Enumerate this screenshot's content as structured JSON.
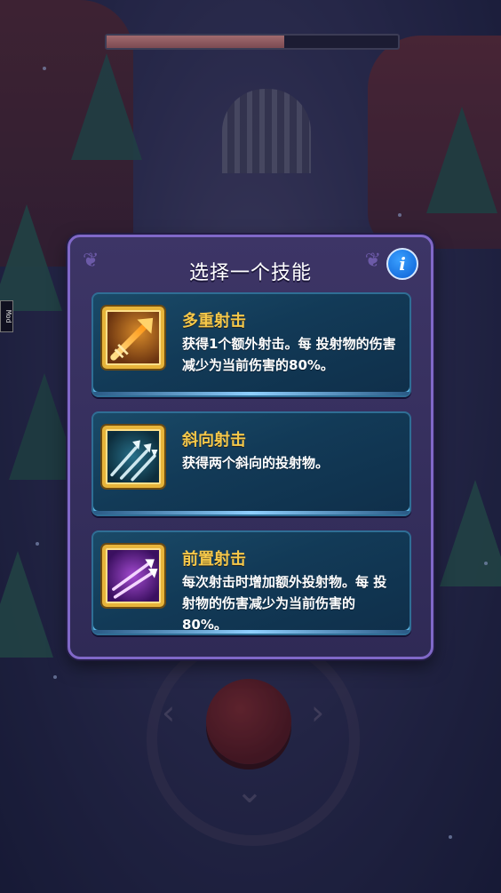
{
  "dialog": {
    "title": "选择一个技能"
  },
  "skills": [
    {
      "name": "多重射击",
      "description": "获得1个额外射击。每 投射物的伤害减少为当前伤害的80%。",
      "icon": "golden-arrow-icon"
    },
    {
      "name": "斜向射击",
      "description": "获得两个斜向的投射物。",
      "icon": "diagonal-arrows-icon"
    },
    {
      "name": "前置射击",
      "description": "每次射击时增加额外投射物。每 投射物的伤害减少为当前伤害的80%。",
      "icon": "purple-arrows-icon"
    }
  ],
  "hud": {
    "progress": 0.61
  },
  "mod_tab": "Mod",
  "colors": {
    "title_gold": "#f5c84a",
    "dialog_border": "#8068c8",
    "info_blue": "#1a7df0"
  }
}
